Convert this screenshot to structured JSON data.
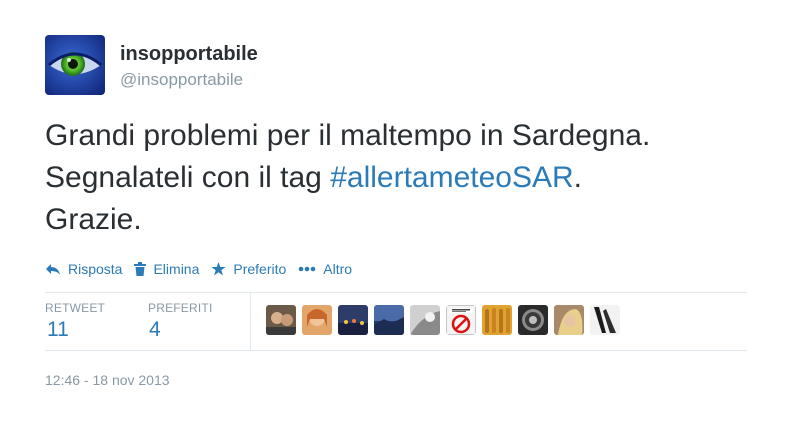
{
  "author": {
    "fullname": "insopportabile",
    "username": "@insopportabile",
    "avatar_icon": "green-eye-avatar"
  },
  "tweet": {
    "line1": "Grandi problemi per il maltempo in Sardegna.",
    "line2_prefix": "Segnalateli con il tag ",
    "hashtag": "#allertameteoSAR",
    "line2_suffix": ".",
    "line3": "Grazie."
  },
  "actions": {
    "reply": {
      "label": "Risposta",
      "icon": "reply-icon"
    },
    "delete": {
      "label": "Elimina",
      "icon": "trash-icon"
    },
    "favorite": {
      "label": "Preferito",
      "icon": "star-icon"
    },
    "more": {
      "label": "Altro",
      "icon": "more-dots-icon"
    }
  },
  "stats": {
    "retweet_label": "RETWEET",
    "retweet_count": "11",
    "favorites_label": "PREFERITI",
    "favorites_count": "4"
  },
  "favoriter_avatars": [
    {
      "name": "user-avatar-1",
      "color": "#7a6a5a"
    },
    {
      "name": "user-avatar-2",
      "color": "#d9935a"
    },
    {
      "name": "user-avatar-3",
      "color": "#3b4a6b"
    },
    {
      "name": "user-avatar-4",
      "color": "#3a4f7a"
    },
    {
      "name": "user-avatar-5",
      "color": "#c8c8c8"
    },
    {
      "name": "user-avatar-6",
      "color": "#e8e8e8"
    },
    {
      "name": "user-avatar-7",
      "color": "#d69a2a"
    },
    {
      "name": "user-avatar-8",
      "color": "#4a4a4a"
    },
    {
      "name": "user-avatar-9",
      "color": "#b79b7a"
    },
    {
      "name": "user-avatar-10",
      "color": "#2a2a2a"
    }
  ],
  "timestamp": "12:46 - 18 nov 2013",
  "colors": {
    "link_blue": "#2b7bb9",
    "text_dark": "#292f33",
    "text_gray": "#8899a6",
    "divider": "#e1e8ed"
  }
}
